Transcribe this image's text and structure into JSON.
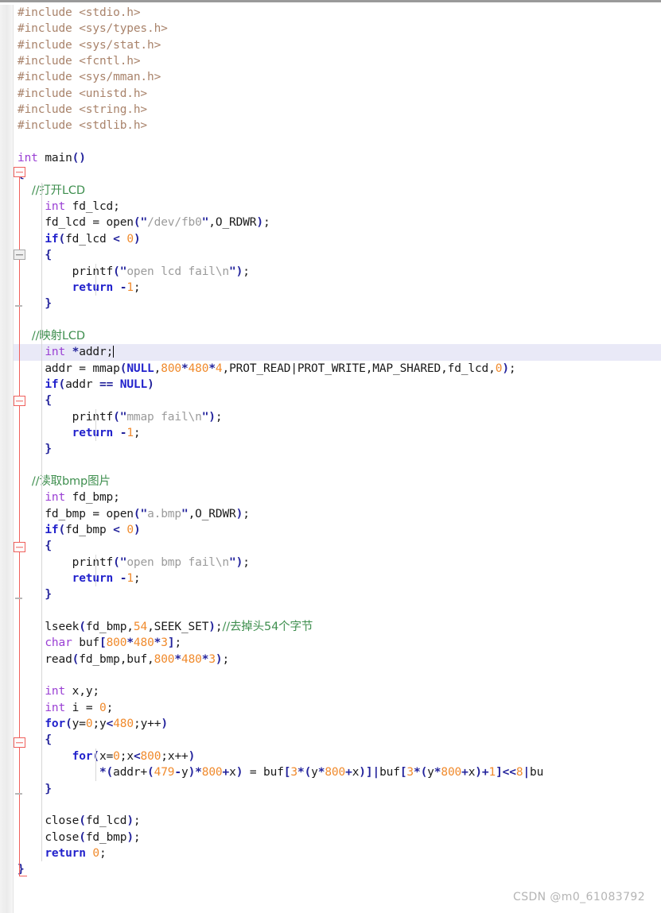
{
  "editor": {
    "language": "c",
    "watermark": "CSDN @m0_61083792",
    "current_line_index": 17,
    "colors": {
      "background": "#ffffff",
      "gutter": "#efefef",
      "current_line_highlight": "#e9e9f7",
      "fold_line": "#f0605c",
      "preprocessor": "#a9836b",
      "type_keyword": "#9a3fd4",
      "keyword": "#2222cc",
      "number": "#f08a2c",
      "string": "#9b9b9b",
      "punctuation": "#24249c",
      "comment": "#3f8f4f",
      "plain_text": "#1a1a1a",
      "watermark": "#b4b4b4"
    }
  },
  "code_lines": [
    "#include <stdio.h>",
    "#include <sys/types.h>",
    "#include <sys/stat.h>",
    "#include <fcntl.h>",
    "#include <sys/mman.h>",
    "#include <unistd.h>",
    "#include <string.h>",
    "#include <stdlib.h>",
    "",
    "int main()",
    "{",
    "    //打开LCD",
    "    int fd_lcd;",
    "    fd_lcd = open(\"/dev/fb0\",O_RDWR);",
    "    if(fd_lcd < 0)",
    "    {",
    "        printf(\"open lcd fail\\n\");",
    "        return -1;",
    "    }",
    "",
    "    //映射LCD",
    "    int *addr;",
    "    addr = mmap(NULL,800*480*4,PROT_READ|PROT_WRITE,MAP_SHARED,fd_lcd,0);",
    "    if(addr == NULL)",
    "    {",
    "        printf(\"mmap fail\\n\");",
    "        return -1;",
    "    }",
    "",
    "    //读取bmp图片",
    "    int fd_bmp;",
    "    fd_bmp = open(\"a.bmp\",O_RDWR);",
    "    if(fd_bmp < 0)",
    "    {",
    "        printf(\"open bmp fail\\n\");",
    "        return -1;",
    "    }",
    "",
    "    lseek(fd_bmp,54,SEEK_SET);//去掉头54个字节",
    "    char buf[800*480*3];",
    "    read(fd_bmp,buf,800*480*3);",
    "",
    "    int x,y;",
    "    int i = 0;",
    "    for(y=0;y<480;y++)",
    "    {",
    "        for(x=0;x<800;x++)",
    "            *(addr+(479-y)*800+x) = buf[3*(y*800+x)]|buf[3*(y*800+x)+1]<<8|bu",
    "    }",
    "",
    "    close(fd_lcd);",
    "    close(fd_bmp);",
    "    return 0;",
    "}"
  ],
  "fold_markers": [
    {
      "label": "fold-main-open",
      "style": "red",
      "line": 10
    },
    {
      "label": "fold-if-lcd",
      "style": "gray",
      "line": 15
    },
    {
      "label": "fold-if-addr",
      "style": "red",
      "line": 23
    },
    {
      "label": "fold-if-bmp",
      "style": "red",
      "line": 32
    },
    {
      "label": "fold-for-loop",
      "style": "red",
      "line": 43
    }
  ]
}
